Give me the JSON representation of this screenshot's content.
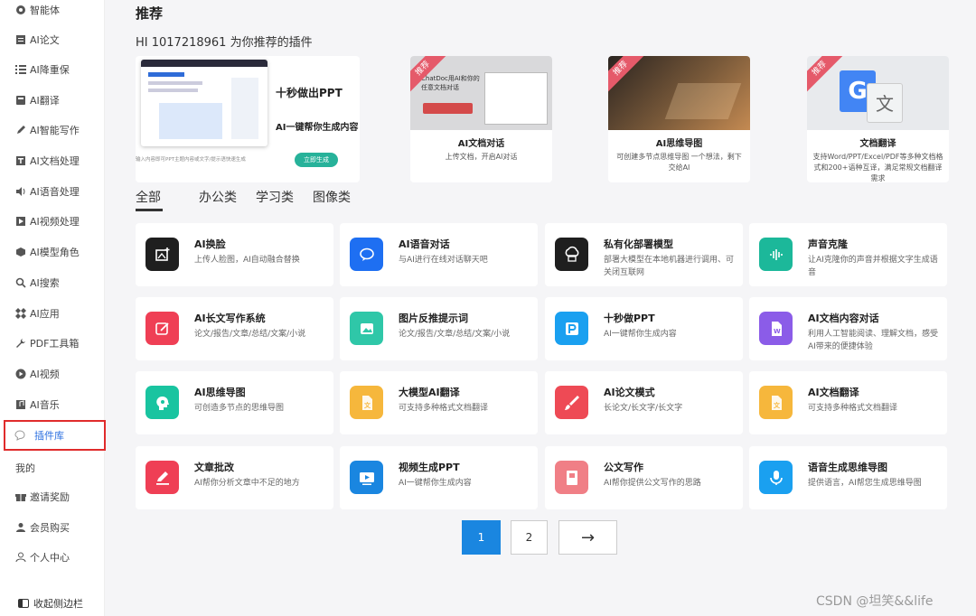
{
  "sidebar": {
    "items": [
      {
        "label": "智能体",
        "icon": "agent-icon"
      },
      {
        "label": "AI论文",
        "icon": "document-icon"
      },
      {
        "label": "AI降重保",
        "icon": "list-icon"
      },
      {
        "label": "AI翻译",
        "icon": "translate-icon"
      },
      {
        "label": "AI智能写作",
        "icon": "pen-icon"
      },
      {
        "label": "AI文档处理",
        "icon": "text-doc-icon"
      },
      {
        "label": "AI语音处理",
        "icon": "speaker-icon"
      },
      {
        "label": "AI视频处理",
        "icon": "play-icon"
      },
      {
        "label": "AI模型角色",
        "icon": "cube-icon"
      },
      {
        "label": "AI搜索",
        "icon": "search-icon"
      },
      {
        "label": "AI应用",
        "icon": "apps-icon"
      },
      {
        "label": "PDF工具箱",
        "icon": "wrench-icon"
      },
      {
        "label": "AI视频",
        "icon": "play-circle-icon"
      },
      {
        "label": "AI音乐",
        "icon": "music-icon"
      },
      {
        "label": "插件库",
        "icon": "plugin-icon"
      }
    ],
    "mine_label": "我的",
    "mine_items": [
      {
        "label": "邀请奖励",
        "icon": "gift-icon"
      },
      {
        "label": "会员购买",
        "icon": "member-icon"
      },
      {
        "label": "个人中心",
        "icon": "user-icon"
      }
    ],
    "collapse_label": "收起侧边栏"
  },
  "header": {
    "title": "推荐",
    "greeting": "HI 1017218961 为你推荐的插件"
  },
  "featured": [
    {
      "banner_title": "十秒做出PPT",
      "banner_sub": "AI一键帮你生成内容",
      "banner_foot": "输入内容即可PPT主题内容或文字/提示语快速生成",
      "banner_button": "立即生成"
    },
    {
      "badge": "推荐",
      "image_text": "ChatDoc用AI和你的任意文档对话",
      "title": "AI文档对话",
      "desc": "上传文档，开启AI对话"
    },
    {
      "badge": "推荐",
      "title": "AI思维导图",
      "desc": "可创建多节点思维导图 一个想法，剩下交给AI"
    },
    {
      "badge": "推荐",
      "title": "文档翻译",
      "desc": "支持Word/PPT/Excel/PDF等多种文档格式和200+语种互译，满足常规文档翻译需求"
    }
  ],
  "tabs": [
    "全部",
    "办公类",
    "学习类",
    "图像类"
  ],
  "cards": [
    {
      "title": "AI换脸",
      "desc": "上传人脸图，AI自动融合替换",
      "icon": "face-swap-icon",
      "color": "#1f1f1f"
    },
    {
      "title": "AI语音对话",
      "desc": "与AI进行在线对话聊天吧",
      "icon": "chat-bubble-icon",
      "color": "#1e6ff2"
    },
    {
      "title": "私有化部署模型",
      "desc": "部署大模型在本地机器进行调用、可关闭互联网",
      "icon": "cloud-server-icon",
      "color": "#1f1f1f"
    },
    {
      "title": "声音克隆",
      "desc": "让AI克隆你的声音并根据文字生成语音",
      "icon": "voice-wave-icon",
      "color": "#1cb89a"
    },
    {
      "title": "AI长文写作系统",
      "desc": "论文/报告/文章/总结/文案/小说",
      "icon": "edit-icon",
      "color": "#ef3f55"
    },
    {
      "title": "图片反推提示词",
      "desc": "论文/报告/文章/总结/文案/小说",
      "icon": "image-icon",
      "color": "#2fc7a8"
    },
    {
      "title": "十秒做PPT",
      "desc": "AI一键帮你生成内容",
      "icon": "ppt-icon",
      "color": "#1aa0f0"
    },
    {
      "title": "AI文档内容对话",
      "desc": "利用人工智能阅读、理解文档，感受AI带来的便捷体验",
      "icon": "word-doc-icon",
      "color": "#8b5ce8"
    },
    {
      "title": "AI思维导图",
      "desc": "可创造多节点的思维导图",
      "icon": "mind-head-icon",
      "color": "#19c4a0"
    },
    {
      "title": "大模型AI翻译",
      "desc": "可支持多种格式文档翻译",
      "icon": "doc-translate-icon",
      "color": "#f6b73c"
    },
    {
      "title": "AI论文模式",
      "desc": "长论文/长文字/长文字",
      "icon": "brush-icon",
      "color": "#ee4a55"
    },
    {
      "title": "AI文档翻译",
      "desc": "可支持多种格式文档翻译",
      "icon": "doc-translate-icon",
      "color": "#f6b73c"
    },
    {
      "title": "文章批改",
      "desc": "AI帮你分析文章中不足的地方",
      "icon": "correct-pen-icon",
      "color": "#ef3f55"
    },
    {
      "title": "视频生成PPT",
      "desc": "AI一键帮你生成内容",
      "icon": "video-icon",
      "color": "#1a86e0"
    },
    {
      "title": "公文写作",
      "desc": "AI帮你提供公文写作的思路",
      "icon": "official-doc-icon",
      "color": "#f07f86"
    },
    {
      "title": "语音生成思维导图",
      "desc": "提供语言，AI帮您生成思维导图",
      "icon": "microphone-icon",
      "color": "#1aa0f0"
    }
  ],
  "pagination": {
    "pages": [
      "1",
      "2"
    ],
    "next": "→",
    "current": "1"
  },
  "watermark": "CSDN @坦笑&&life"
}
